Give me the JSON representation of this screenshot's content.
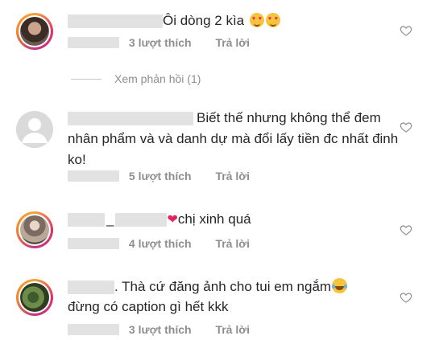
{
  "comments": [
    {
      "text": "Ôi dòng 2 kìa",
      "likes": "3 lượt thích",
      "reply": "Trả lời",
      "view_replies": "Xem phản hồi (1)"
    },
    {
      "text": "Biết thế nhưng không thể đem nhân phẩm và và danh dự mà đổi lấy tiền đc nhất đinh ko!",
      "likes": "5 lượt thích",
      "reply": "Trả lời"
    },
    {
      "text_prefix": "_",
      "text": "chị xinh quá",
      "likes": "4 lượt thích",
      "reply": "Trả lời"
    },
    {
      "text": ". Thà cứ đăng ảnh cho tui em ngắm",
      "text_line2": "đừng có caption gì hết kkk",
      "likes": "3 lượt thích",
      "reply": "Trả lời"
    }
  ],
  "icons": {
    "like": "heart-outline-icon",
    "avatar_placeholder": "default-avatar-icon"
  },
  "colors": {
    "text": "#262626",
    "meta": "#8e8e8e",
    "redaction": "#e2e2e2"
  }
}
